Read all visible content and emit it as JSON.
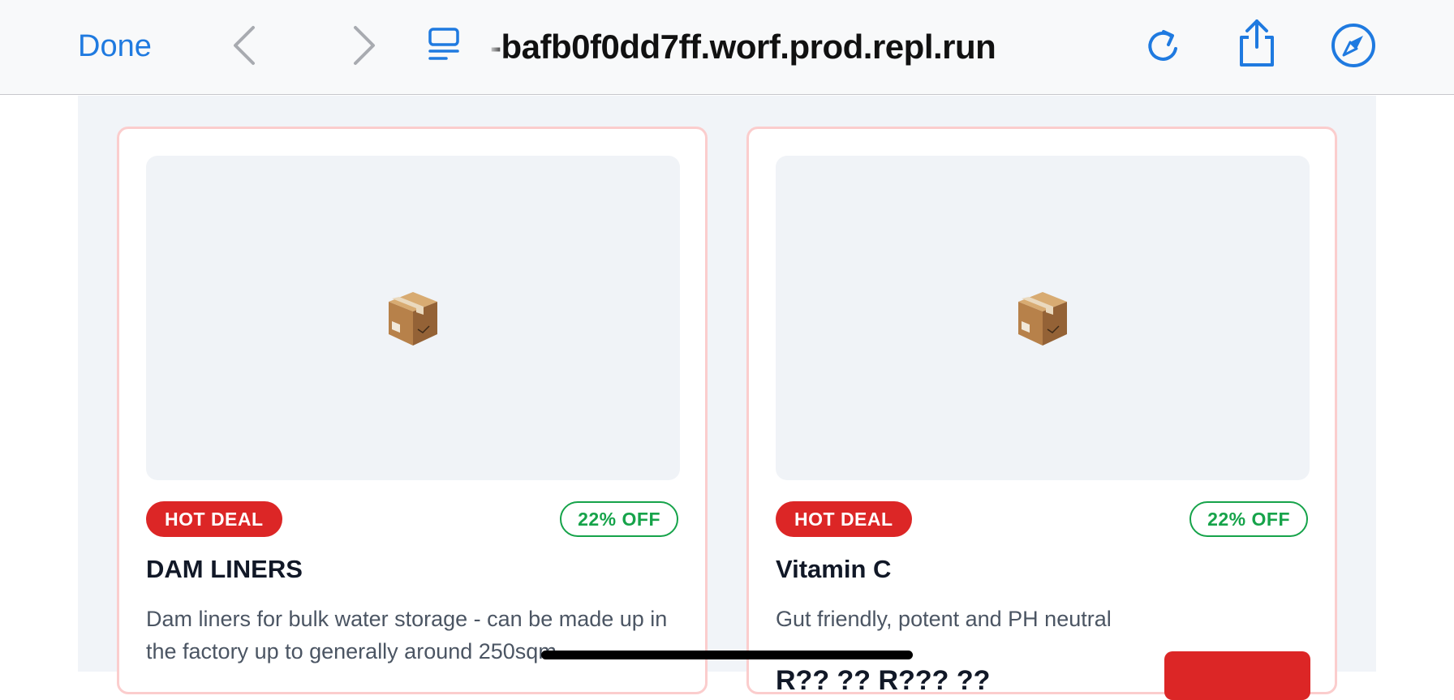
{
  "toolbar": {
    "done_label": "Done",
    "url": "-bafb0f0dd7ff.worf.prod.repl.run",
    "accent_color": "#1f7ae0"
  },
  "products": [
    {
      "badge_hot": "HOT DEAL",
      "badge_off": "22% OFF",
      "name": "DAM LINERS",
      "description": "Dam liners for bulk water storage - can be made up in the factory up to generally around 250sqm",
      "image_icon": "package-box-icon"
    },
    {
      "badge_hot": "HOT DEAL",
      "badge_off": "22% OFF",
      "name": "Vitamin C",
      "description": "Gut friendly, potent and PH neutral",
      "price": "R?? ?? R??? ??",
      "image_icon": "package-box-icon"
    }
  ],
  "colors": {
    "hot_badge": "#dc2626",
    "off_badge": "#16a34a",
    "card_border": "#fbcdcd"
  }
}
